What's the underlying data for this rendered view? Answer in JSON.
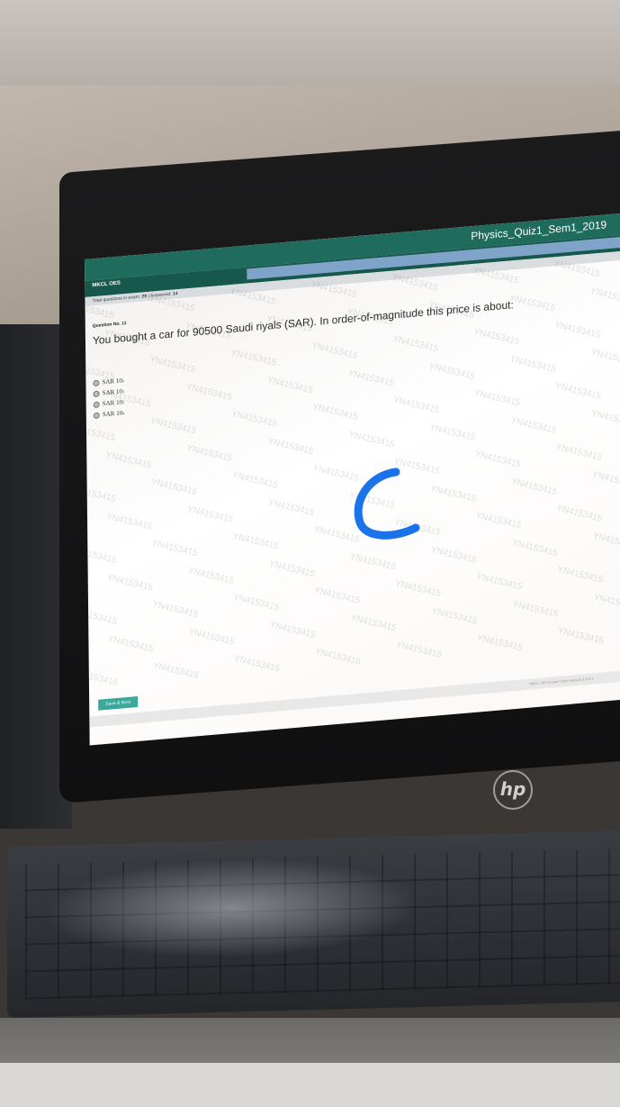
{
  "exam": {
    "title": "Physics_Quiz1_Sem1_2019",
    "brand": "MKCL OES"
  },
  "status": {
    "total_label": "Total questions in exam:",
    "total_value": "29",
    "answered_label": "| Answered:",
    "answered_value": "14"
  },
  "question": {
    "number": "Question No. 11",
    "text": "You bought a car for 90500 Saudi riyals (SAR). In order-of-magnitude this price is about:",
    "options": [
      {
        "base": "SAR 10",
        "exp": "6"
      },
      {
        "base": "SAR 10",
        "exp": "3"
      },
      {
        "base": "SAR 10",
        "exp": "5"
      },
      {
        "base": "SAR 10",
        "exp": "4"
      }
    ]
  },
  "watermark": "YN4153415",
  "actions": {
    "save_next": "Save & Next"
  },
  "footer": {
    "version": "MKCL OES Exam Client Version 2.0.0.1"
  },
  "hardware": {
    "logo": "hp"
  },
  "annotation": {
    "letter": "C",
    "color": "#1a73e8"
  }
}
